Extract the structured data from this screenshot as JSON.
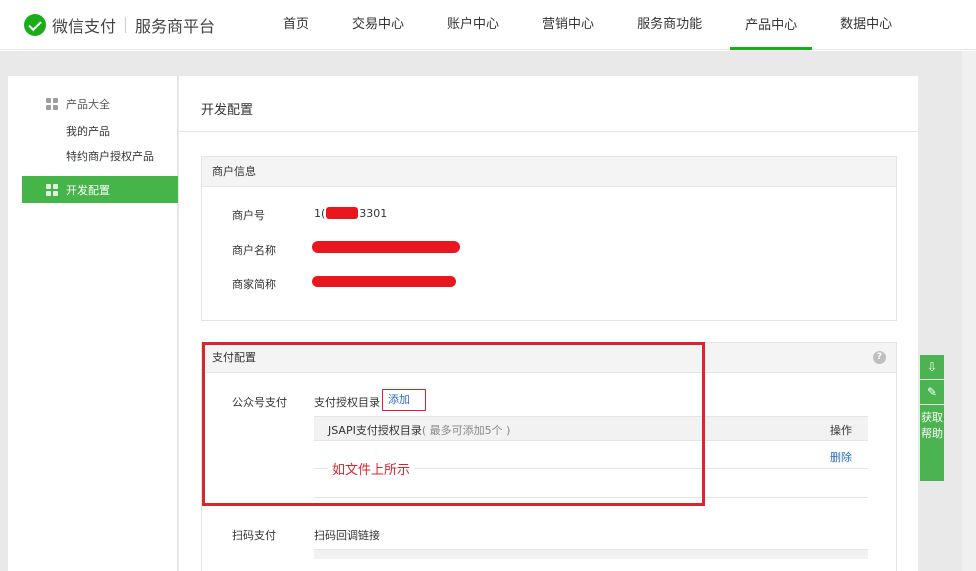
{
  "header": {
    "brand": "微信支付",
    "platform": "服务商平台",
    "nav": [
      {
        "label": "首页"
      },
      {
        "label": "交易中心"
      },
      {
        "label": "账户中心"
      },
      {
        "label": "营销中心"
      },
      {
        "label": "服务商功能"
      },
      {
        "label": "产品中心",
        "active": true
      },
      {
        "label": "数据中心"
      }
    ]
  },
  "sidebar": {
    "group_label": "产品大全",
    "items": [
      "我的产品",
      "特约商户授权产品"
    ],
    "active_label": "开发配置"
  },
  "main": {
    "title": "开发配置",
    "merchant_info": {
      "header": "商户信息",
      "rows": [
        {
          "label": "商户号",
          "value_prefix": "1(",
          "value_suffix": "3301"
        },
        {
          "label": "商户名称"
        },
        {
          "label": "商家简称"
        }
      ]
    },
    "payment_config": {
      "header": "支付配置",
      "help_icon": "?",
      "public_account_pay": {
        "label": "公众号支付",
        "dir_label": "支付授权目录",
        "add_link": "添加",
        "table_header": "JSAPI支付授权目录",
        "table_note": "( 最多可添加5个 )",
        "op_header": "操作",
        "delete_link": "删除",
        "annotation": "如文件上所示"
      },
      "scan_pay": {
        "label": "扫码支付",
        "callback_label": "扫码回调链接"
      }
    }
  },
  "float_toolbar": {
    "download_icon": "download-icon",
    "edit_icon": "edit-icon",
    "help_text": "获取帮助"
  },
  "colors": {
    "brand_green": "#1aad19",
    "active_green": "#46b549",
    "annotation_red": "#d9262c",
    "link_blue": "#2a6bbf"
  }
}
